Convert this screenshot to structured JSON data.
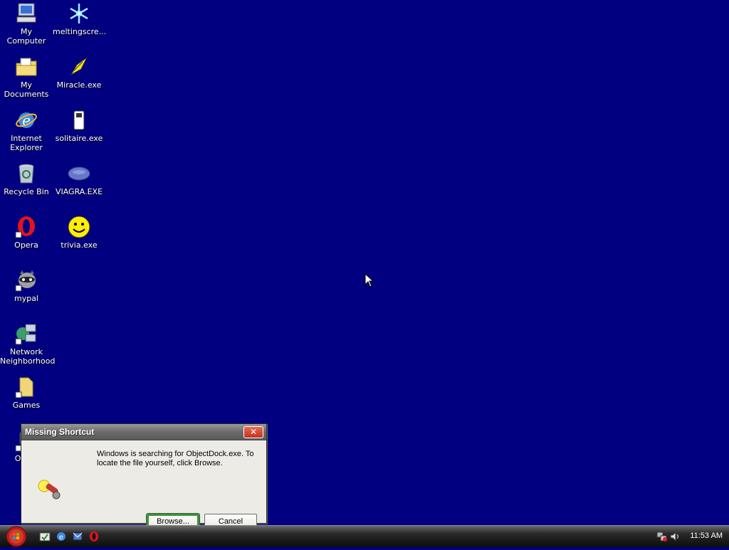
{
  "desktop": {
    "background_color": "#000080",
    "icons": [
      {
        "label": "My Computer",
        "icon": "computer-icon"
      },
      {
        "label": "meltingscre...",
        "icon": "snowflake-icon"
      },
      {
        "label": "My Documents",
        "icon": "documents-folder-icon"
      },
      {
        "label": "Miracle.exe",
        "icon": "wand-icon"
      },
      {
        "label": "Internet Explorer",
        "icon": "internet-explorer-icon"
      },
      {
        "label": "solitaire.exe",
        "icon": "solitaire-icon"
      },
      {
        "label": "Recycle Bin",
        "icon": "recycle-bin-icon"
      },
      {
        "label": "VIAGRA.EXE",
        "icon": "pill-icon"
      },
      {
        "label": "Opera",
        "icon": "opera-icon"
      },
      {
        "label": "trivia.exe",
        "icon": "smiley-icon"
      },
      {
        "label": "mypal",
        "icon": "raccoon-icon"
      },
      {
        "label": "Network Neighborhood",
        "icon": "network-icon"
      },
      {
        "label": "Games",
        "icon": "folder-icon"
      },
      {
        "label": "Ou Ex",
        "icon": "outlook-express-icon"
      }
    ]
  },
  "dialog": {
    "title": "Missing Shortcut",
    "close_label": "✕",
    "message": "Windows is searching for ObjectDock.exe. To locate the file yourself, click Browse.",
    "icon": "search-flashlight-icon",
    "browse_label": "Browse...",
    "cancel_label": "Cancel"
  },
  "taskbar": {
    "start_icon": "start-orb-icon",
    "quick_launch": [
      "show-desktop-icon",
      "internet-explorer-icon",
      "outlook-icon",
      "opera-icon"
    ],
    "tray_icons": [
      "network-status-icon",
      "volume-icon"
    ],
    "clock": "11:53 AM"
  }
}
